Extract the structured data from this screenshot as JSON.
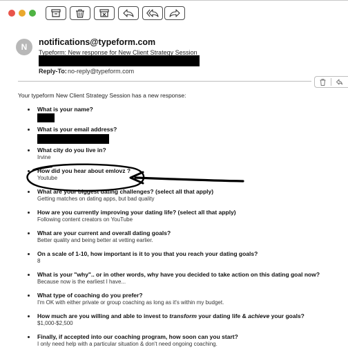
{
  "toolbar": {
    "traffic_colors": [
      "#e9544a",
      "#eaa82d",
      "#4fb343"
    ],
    "buttons": [
      "archive-icon",
      "trash-icon",
      "junk-icon",
      "reply-icon",
      "reply-all-icon",
      "forward-icon"
    ]
  },
  "message": {
    "avatar_letter": "N",
    "sender": "notifications@typeform.com",
    "subject": "Typeform: New response for New Client Strategy Session",
    "reply_to_label": "Reply-To:",
    "reply_to": "no-reply@typeform.com",
    "intro": "Your typeform New Client Strategy Session has a new response:"
  },
  "qa": [
    {
      "q": "What is your name?",
      "a": ""
    },
    {
      "q": "What is your email address?",
      "a": ""
    },
    {
      "q": "What city do you live in?",
      "a": "Irvine"
    },
    {
      "q": "How did you hear about emlovz ?",
      "a": "Youtube"
    },
    {
      "q": "What are your biggest dating challenges? (select all that apply)",
      "a": "Getting matches on dating apps, but bad quality"
    },
    {
      "q": "How are you currently improving your dating life? (select all that apply)",
      "a": "Following content creators on YouTube"
    },
    {
      "q": "What are your current and overall dating goals?",
      "a": "Better quality and being better at vetting earlier."
    },
    {
      "q": "On a scale of 1-10, how important is it to you that you reach your dating goals?",
      "a": "8"
    },
    {
      "q": "What is your \"why\".. or in other words, why have you decided to take action on this dating goal now?",
      "a": "Because now is the earliest I have..."
    },
    {
      "q": "What type of coaching do you prefer?",
      "a": "I'm OK with either private or group coaching as long as it's within my budget."
    },
    {
      "q": "How much are you willing and able to invest to transform your dating life & achieve your goals?",
      "a": "$1,000-$2,500"
    },
    {
      "q": "Finally, if accepted into our coaching program, how soon can you start?",
      "a": "I only need help with a particular situation & don't need ongoing coaching."
    }
  ],
  "annotation": {
    "shape": "hand-drawn ellipse around the \"How did you hear about emlovz ?\" answer with an arrow pointing to it",
    "color": "#000000"
  }
}
